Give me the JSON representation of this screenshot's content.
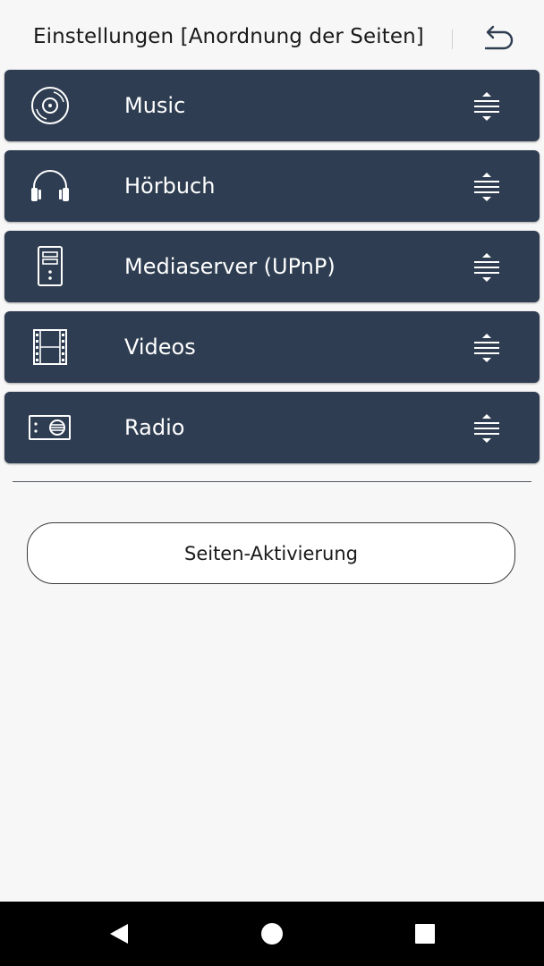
{
  "header": {
    "title": "Einstellungen [Anordnung der Seiten]",
    "back_icon": "undo-arrow-icon"
  },
  "colors": {
    "row_background": "#2e3d51",
    "row_text": "#ffffff",
    "page_background": "#f7f7f7"
  },
  "pages": [
    {
      "label": "Music",
      "icon": "vinyl-disc-icon",
      "handle_icon": "drag-handle-icon"
    },
    {
      "label": "Hörbuch",
      "icon": "headphones-icon",
      "handle_icon": "drag-handle-icon"
    },
    {
      "label": "Mediaserver (UPnP)",
      "icon": "media-server-icon",
      "handle_icon": "drag-handle-icon"
    },
    {
      "label": "Videos",
      "icon": "film-strip-icon",
      "handle_icon": "drag-handle-icon"
    },
    {
      "label": "Radio",
      "icon": "radio-icon",
      "handle_icon": "drag-handle-icon"
    }
  ],
  "activation_button": {
    "label": "Seiten-Aktivierung"
  },
  "navbar": {
    "back_icon": "nav-back-triangle-icon",
    "home_icon": "nav-home-circle-icon",
    "recents_icon": "nav-recents-square-icon"
  }
}
